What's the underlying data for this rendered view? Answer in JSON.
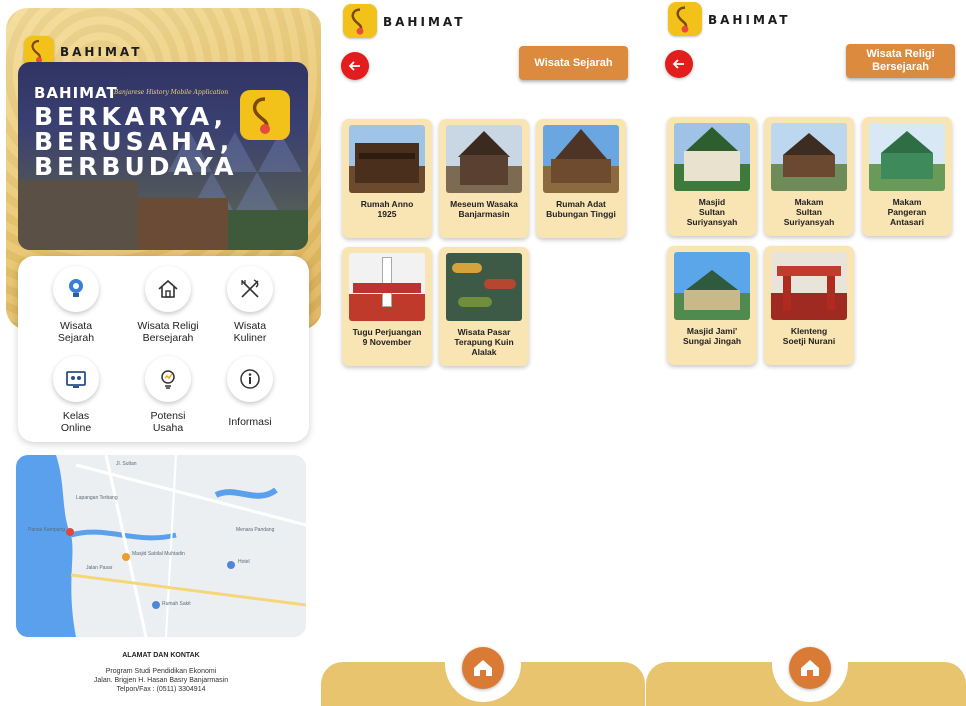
{
  "brand": {
    "name": "BAHIMAT"
  },
  "colors": {
    "gold": "#e9c56d",
    "orange": "#dc8a3e",
    "card": "#f9e4b3",
    "back_red": "#e21d1d",
    "logo_yellow": "#f2c21a"
  },
  "home": {
    "hero": {
      "title": "BAHIMAT",
      "subtitle": "Banjarese History Mobile Application",
      "slogan_lines": [
        "BERKARYA,",
        "BERUSAHA,",
        "BERBUDAYA"
      ]
    },
    "menu": [
      {
        "label": "Wisata\nSejarah",
        "icon": "lightbulb-pin-icon"
      },
      {
        "label": "Wisata Religi\nBersejarah",
        "icon": "house-icon"
      },
      {
        "label": "Wisata\nKuliner",
        "icon": "fork-knife-icon"
      },
      {
        "label": "Kelas\nOnline",
        "icon": "monitor-class-icon"
      },
      {
        "label": "Potensi\nUsaha",
        "icon": "growth-idea-icon"
      },
      {
        "label": "Informasi",
        "icon": "info-icon"
      }
    ],
    "map_labels": [
      "Jl. Sultan",
      "Pantai Kampung",
      "Lapangan Terbang",
      "Menara Pandang",
      "Jalan Pasar",
      "Masjid Sabilal Muhtadin",
      "Hotel",
      "Rumah Sakit"
    ],
    "contact": {
      "title": "ALAMAT DAN KONTAK",
      "lines": [
        "Program Studi Pendidikan Ekonomi",
        "Jalan. Brigjen H. Hasan Basry Banjarmasin",
        "Telpon/Fax : (0511) 3304914"
      ]
    }
  },
  "sejarah": {
    "title": "Wisata Sejarah",
    "cards": [
      {
        "label": "Rumah Anno\n1925"
      },
      {
        "label": "Meseum Wasaka\nBanjarmasin"
      },
      {
        "label": "Rumah Adat\nBubungan Tinggi"
      },
      {
        "label": "Tugu Perjuangan\n9 November"
      },
      {
        "label": "Wisata Pasar\nTerapung Kuin\nAlalak"
      }
    ]
  },
  "religi": {
    "title": "Wisata Religi\nBersejarah",
    "cards": [
      {
        "label": "Masjid\nSultan\nSuriyansyah"
      },
      {
        "label": "Makam\nSultan\nSuriyansyah"
      },
      {
        "label": "Makam\nPangeran\nAntasari"
      },
      {
        "label": "Masjid Jami'\nSungai Jingah"
      },
      {
        "label": "Klenteng\nSoetji Nurani"
      }
    ]
  }
}
